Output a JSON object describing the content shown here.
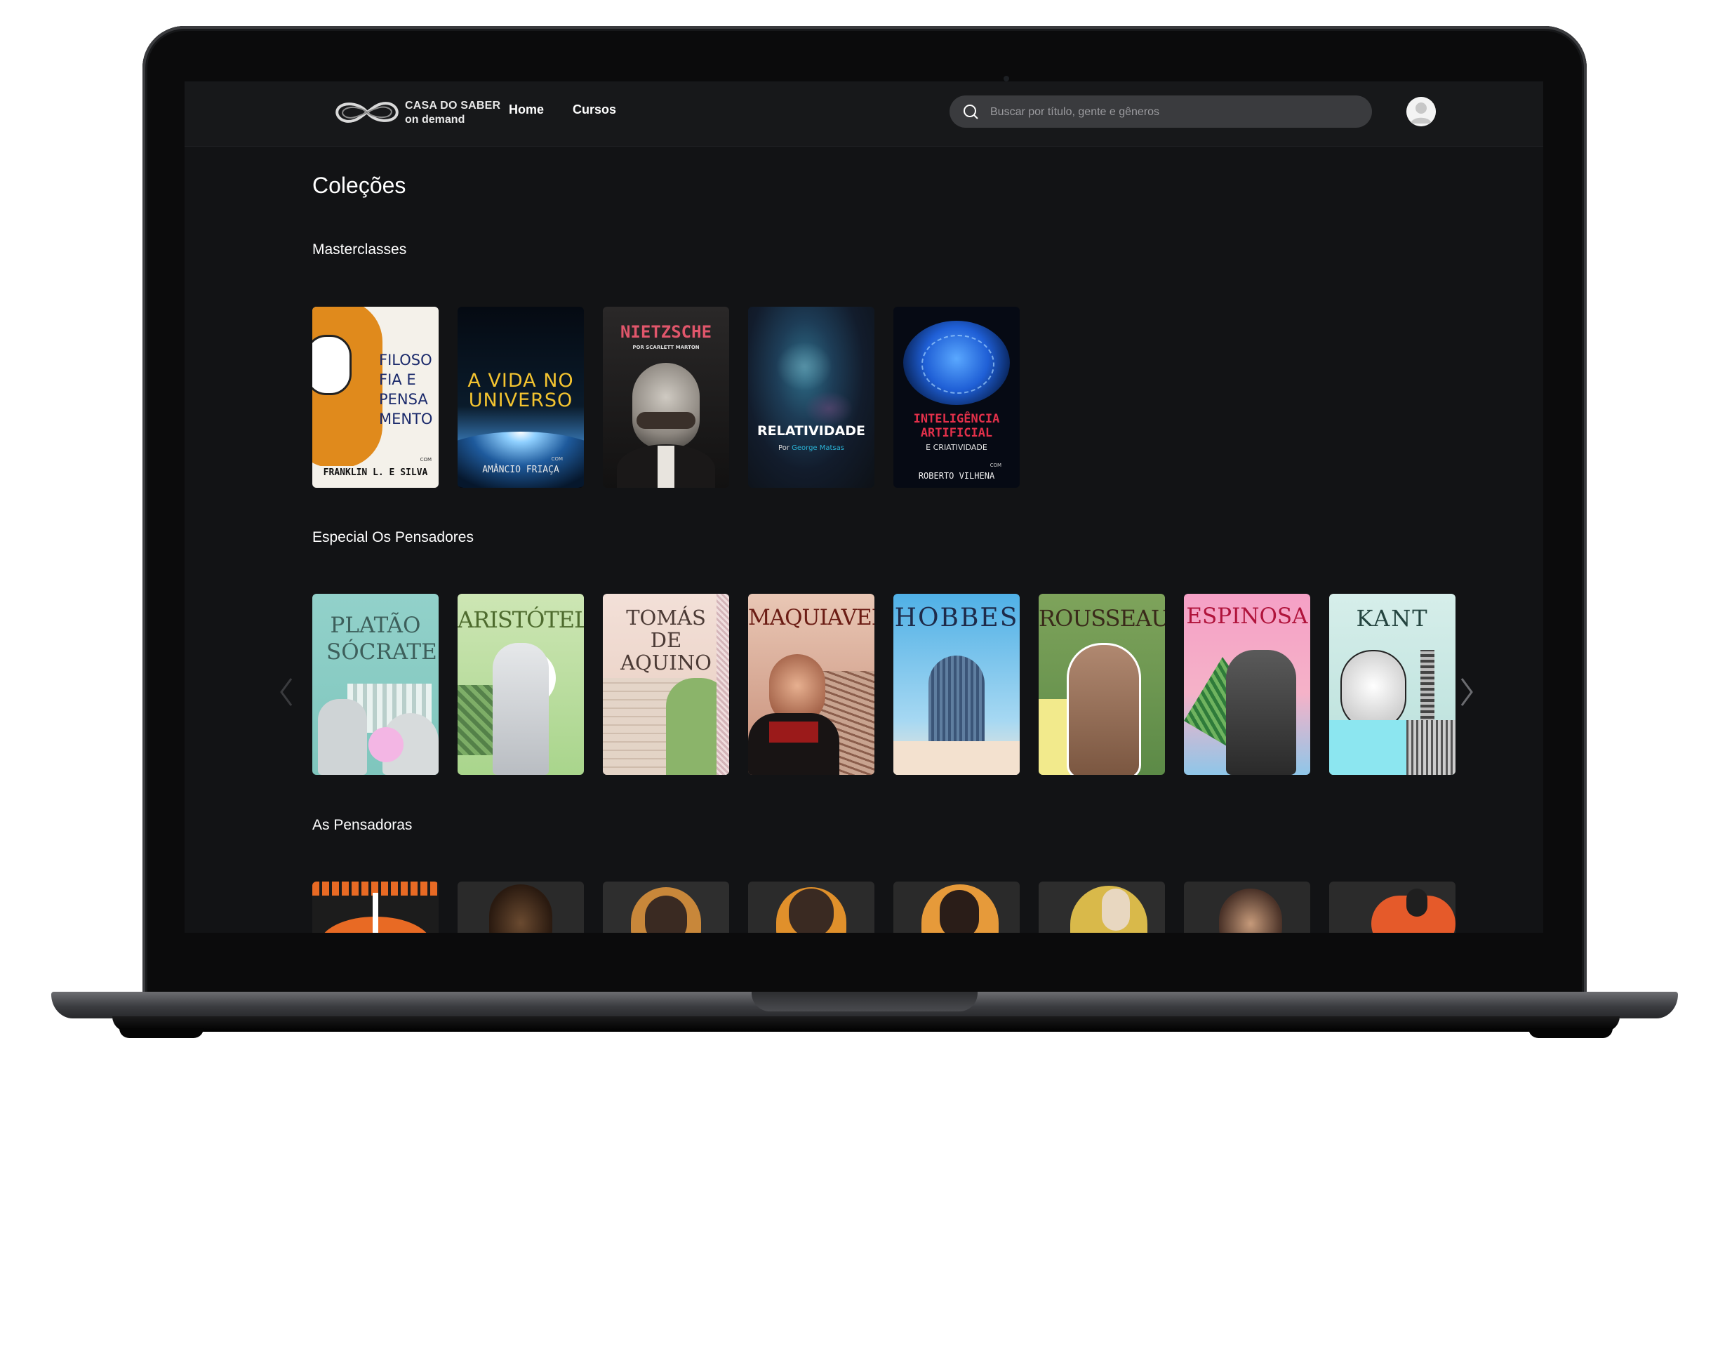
{
  "brand": {
    "line1": "CASA DO SABER",
    "line2": "on demand",
    "logo_icon": "infinity-icon"
  },
  "nav": {
    "home": "Home",
    "courses": "Cursos"
  },
  "search": {
    "placeholder": "Buscar por título, gente e gêneros",
    "value": ""
  },
  "page": {
    "title": "Coleções"
  },
  "sections": [
    {
      "title": "Masterclasses",
      "cards": [
        {
          "title": "FILOSO FIA E PENSA MENTO",
          "pre": "COM",
          "author": "FRANKLIN L. E SILVA",
          "bg": "#f4f1ea",
          "accent": "#e08a1c"
        },
        {
          "title": "A VIDA NO UNIVERSO",
          "pre": "COM",
          "author": "AMÂNCIO FRIAÇA",
          "bg": "#07121c",
          "accent": "#f4c430"
        },
        {
          "title": "NIETZSCHE",
          "sub": "POR SCARLETT MARTON",
          "bg": "#1b1a1a",
          "accent": "#e0566b"
        },
        {
          "title": "RELATIVIDADE",
          "sub_prefix": "Por",
          "sub": "George Matsas",
          "bg": "#0d1116",
          "accent": "#2bb3d6"
        },
        {
          "title": "INTELIGÊNCIA ARTIFICIAL",
          "sub": "E CRIATIVIDADE",
          "pre": "COM",
          "author": "ROBERTO VILHENA",
          "bg": "#060a14",
          "accent": "#e2304a"
        }
      ]
    },
    {
      "title": "Especial Os Pensadores",
      "cards": [
        {
          "title": "PLATÃO SÓCRATES",
          "bg": "#8fcdc6",
          "accent": "#3d5f5b"
        },
        {
          "title": "ARISTÓTELES",
          "bg": "#bfe1a0",
          "accent": "#4e6b2e"
        },
        {
          "title": "TOMÁS DE AQUINO",
          "bg": "#f0d9cf",
          "accent": "#4b3a35"
        },
        {
          "title": "MAQUIAVEL",
          "bg": "#d89d86",
          "accent": "#6b1c14"
        },
        {
          "title": "HOBBES",
          "bg": "#5fb6e4",
          "accent": "#1e2b4a"
        },
        {
          "title": "ROUSSEAU",
          "bg": "#7a9c59",
          "accent": "#3a2a1a"
        },
        {
          "title": "ESPINOSA",
          "bg": "#f2a6c2",
          "accent": "#b0133b"
        },
        {
          "title": "KANT",
          "bg": "#cbe8e4",
          "accent": "#24443f"
        }
      ]
    },
    {
      "title": "As Pensadoras",
      "cards": [
        {
          "bg": "#1c1c1c",
          "accent": "#e86a24"
        },
        {
          "bg": "#2a2a2a",
          "accent": "#3b2a20"
        },
        {
          "bg": "#2e2e2e",
          "accent": "#c8873a"
        },
        {
          "bg": "#2b2b2b",
          "accent": "#e0902b"
        },
        {
          "bg": "#2a2a2a",
          "accent": "#e69a3a"
        },
        {
          "bg": "#2d2d2d",
          "accent": "#d9b94a"
        },
        {
          "bg": "#2a2a2a",
          "accent": "#7a6050"
        },
        {
          "bg": "#2b2b2b",
          "accent": "#e55a2a"
        }
      ]
    }
  ],
  "icons": {
    "search": "search-icon",
    "prev": "chevron-left-icon",
    "next": "chevron-right-icon",
    "avatar": "user-avatar-icon"
  }
}
